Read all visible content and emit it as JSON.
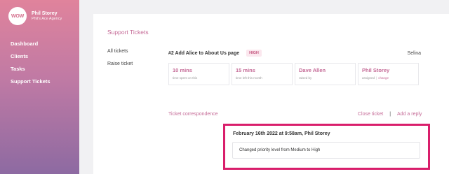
{
  "brand": {
    "logo_text": "WOW",
    "user_name": "Phil Storey",
    "agency": "Phil's Ace Agency"
  },
  "sidebar": {
    "items": [
      {
        "label": "Dashboard"
      },
      {
        "label": "Clients"
      },
      {
        "label": "Tasks"
      },
      {
        "label": "Support Tickets"
      }
    ]
  },
  "page": {
    "title": "Support Tickets"
  },
  "subnav": {
    "items": [
      {
        "label": "All tickets"
      },
      {
        "label": "Raise ticket"
      }
    ]
  },
  "ticket": {
    "title": "#2 Add Alice to About Us page",
    "priority": "HIGH",
    "assignee": "Selina",
    "stats": [
      {
        "value": "10 mins",
        "caption": "time spent on this"
      },
      {
        "value": "15 mins",
        "caption": "time left this month"
      },
      {
        "value": "Dave Allen",
        "caption": "raised by"
      },
      {
        "value": "Phil Storey",
        "caption": "assigned",
        "link": "change"
      }
    ]
  },
  "correspondence": {
    "title": "Ticket correspondence",
    "close_label": "Close ticket",
    "divider": "|",
    "reply_label": "Add a reply",
    "messages": [
      {
        "header": "February 16th 2022 at 9:58am, Phil Storey",
        "body": "Changed priority level from Medium to High"
      }
    ]
  },
  "colors": {
    "accent": "#c56b97",
    "highlight": "#d91e6b",
    "sidebar_top": "#e0839c",
    "sidebar_bottom": "#8d6aa2"
  }
}
